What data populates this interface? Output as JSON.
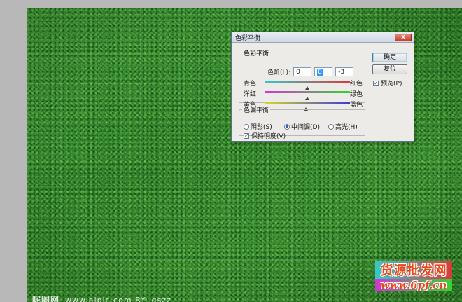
{
  "dialog": {
    "title": "色彩平衡",
    "close_label": "x",
    "balance_group": {
      "legend": "色彩平衡",
      "levels_label": "色阶(L):",
      "levels": [
        "0",
        "0",
        "-3"
      ],
      "sliders": [
        {
          "left": "青色",
          "right": "红色",
          "value": 0,
          "min": -100,
          "max": 100
        },
        {
          "left": "洋红",
          "right": "绿色",
          "value": 0,
          "min": -100,
          "max": 100
        },
        {
          "left": "黄色",
          "right": "蓝色",
          "value": -3,
          "min": -100,
          "max": 100
        }
      ]
    },
    "tone_group": {
      "legend": "色调平衡",
      "options": [
        "阴影(S)",
        "中间调(D)",
        "高光(H)"
      ],
      "selected": 1,
      "preserve_label": "保持明度(V)",
      "preserve_checked": true
    },
    "ok_label": "确定",
    "reset_label": "复位",
    "preview_label": "预览(P)",
    "preview_checked": true
  },
  "watermarks": {
    "left_main": "昵图网",
    "left_sub": "www.nipic.com    BY: gszz",
    "right_line1": "货源批发网",
    "right_line2": "www.6pf.cn"
  },
  "colors": {
    "grass": "#2e8a2a",
    "dialog_bg": "#ecebe8",
    "close_red": "#c5402b"
  }
}
